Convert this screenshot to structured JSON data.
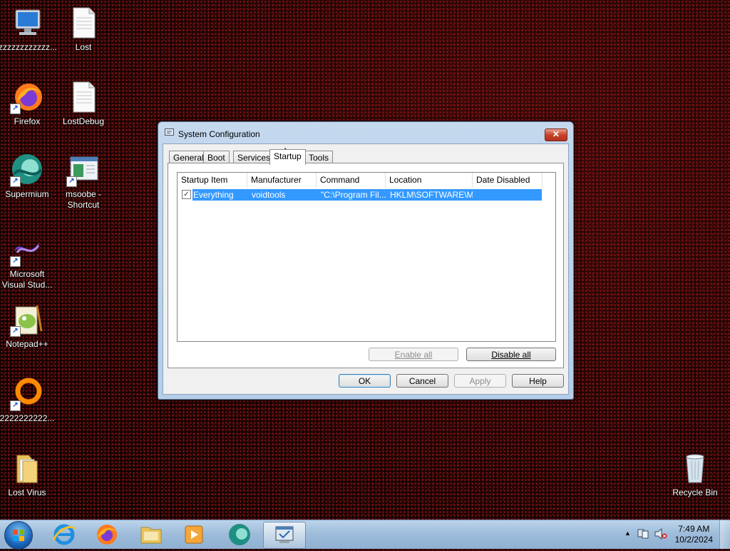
{
  "desktop": {
    "icons": [
      {
        "label": "zzzzzzzzzzzz..."
      },
      {
        "label": "Lost"
      },
      {
        "label": "Firefox"
      },
      {
        "label": "LostDebug"
      },
      {
        "label": "Supermium"
      },
      {
        "label": "msoobe -\nShortcut"
      },
      {
        "label": "Microsoft\nVisual Stud..."
      },
      {
        "label": "Notepad++"
      },
      {
        "label": "2222222222..."
      },
      {
        "label": "Lost Virus"
      },
      {
        "label": "Recycle Bin"
      }
    ]
  },
  "dialog": {
    "title": "System Configuration",
    "close_glyph": "✕",
    "tabs": [
      "General",
      "Boot",
      "Services",
      "Startup",
      "Tools"
    ],
    "active_tab": "Startup",
    "columns": [
      "Startup Item",
      "Manufacturer",
      "Command",
      "Location",
      "Date Disabled"
    ],
    "rows": [
      {
        "checked": true,
        "startup_item": "Everything",
        "manufacturer": "voidtools",
        "command": "\"C:\\Program Fil...",
        "location": "HKLM\\SOFTWARE\\M...",
        "date_disabled": ""
      }
    ],
    "enable_all": "Enable all",
    "disable_all": "Disable all",
    "ok": "OK",
    "cancel": "Cancel",
    "apply": "Apply",
    "help": "Help"
  },
  "taskbar": {
    "pinned": [
      "internet-explorer-icon",
      "firefox-icon",
      "file-explorer-icon",
      "media-player-icon",
      "supermium-icon",
      "system-configuration-icon"
    ],
    "tray": {
      "time": "7:49 AM",
      "date": "10/2/2024",
      "show_hidden": "▲"
    }
  }
}
